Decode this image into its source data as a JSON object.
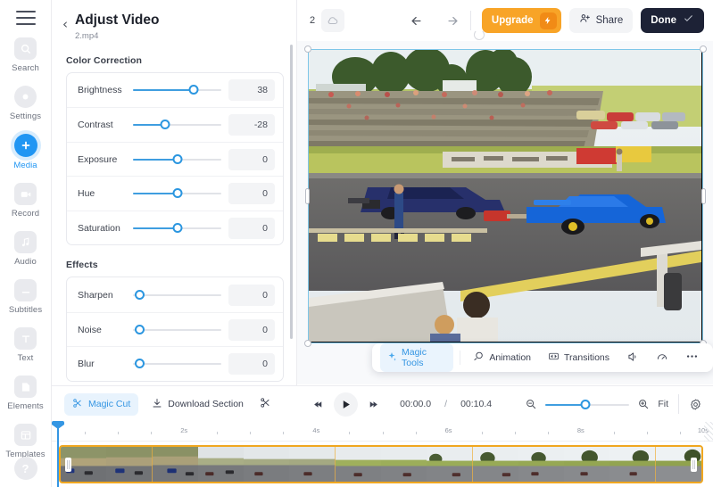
{
  "sidebar": {
    "menu_icon": "hamburger-icon",
    "items": [
      {
        "label": "Search",
        "icon": "search-icon",
        "active": false
      },
      {
        "label": "Settings",
        "icon": "settings-icon",
        "active": false
      },
      {
        "label": "Media",
        "icon": "plus-icon",
        "active": true
      },
      {
        "label": "Record",
        "icon": "record-camera-icon",
        "active": false
      },
      {
        "label": "Audio",
        "icon": "music-note-icon",
        "active": false
      },
      {
        "label": "Subtitles",
        "icon": "subtitles-icon",
        "active": false
      },
      {
        "label": "Text",
        "icon": "text-t-icon",
        "active": false
      },
      {
        "label": "Elements",
        "icon": "elements-shape-icon",
        "active": false
      },
      {
        "label": "Templates",
        "icon": "templates-grid-icon",
        "active": false
      }
    ],
    "help_label": "?"
  },
  "panel": {
    "back_chevron": "‹",
    "title": "Adjust Video",
    "subtitle": "2.mp4",
    "sections": [
      {
        "title": "Color Correction",
        "rows": [
          {
            "label": "Brightness",
            "value": "38",
            "percent": 69
          },
          {
            "label": "Contrast",
            "value": "-28",
            "percent": 36
          },
          {
            "label": "Exposure",
            "value": "0",
            "percent": 50
          },
          {
            "label": "Hue",
            "value": "0",
            "percent": 50
          },
          {
            "label": "Saturation",
            "value": "0",
            "percent": 50
          }
        ]
      },
      {
        "title": "Effects",
        "rows": [
          {
            "label": "Sharpen",
            "value": "0",
            "percent": 0
          },
          {
            "label": "Noise",
            "value": "0",
            "percent": 0
          },
          {
            "label": "Blur",
            "value": "0",
            "percent": 0
          }
        ]
      }
    ]
  },
  "topbar": {
    "page_number": "2",
    "cloud_icon": "cloud-sync-icon",
    "undo_icon": "undo-arrow-icon",
    "redo_icon": "redo-arrow-icon",
    "upgrade_label": "Upgrade",
    "upgrade_icon": "lightning-bolt-icon",
    "upgrade_color": "#f8a427",
    "share_label": "Share",
    "share_icon": "person-add-icon",
    "done_label": "Done",
    "done_icon": "check-icon",
    "done_color": "#1d2236"
  },
  "preview": {
    "float_toolbar": [
      {
        "label": "Magic Tools",
        "icon": "sparkles-icon",
        "active": true
      },
      {
        "label": "Animation",
        "icon": "animation-icon",
        "active": false
      },
      {
        "label": "Transitions",
        "icon": "transitions-icon",
        "active": false
      }
    ],
    "volume_icon": "speaker-icon",
    "speed_icon": "speed-gauge-icon",
    "more_icon": "more-dots-icon"
  },
  "bottombar": {
    "magic_cut_label": "Magic Cut",
    "magic_cut_icon": "magic-scissors-icon",
    "download_label": "Download Section",
    "download_icon": "download-icon",
    "split_icon": "scissors-icon",
    "prev_icon": "skip-back-icon",
    "play_icon": "play-icon",
    "next_icon": "skip-forward-icon",
    "current_time": "00:00.0",
    "time_separator": "/",
    "total_time": "00:10.4",
    "zoom_out_icon": "zoom-out-icon",
    "zoom_in_icon": "zoom-in-icon",
    "zoom_percent": 48,
    "fit_label": "Fit",
    "settings_icon": "gear-icon"
  },
  "timeline": {
    "ruler_labels": [
      "2s",
      "4s",
      "6s",
      "8s",
      "10s"
    ],
    "ruler_positions": [
      20,
      40,
      60,
      80,
      100
    ],
    "playhead_position": 0,
    "clip_selected_color": "#f0a720",
    "frame_count": 14
  }
}
